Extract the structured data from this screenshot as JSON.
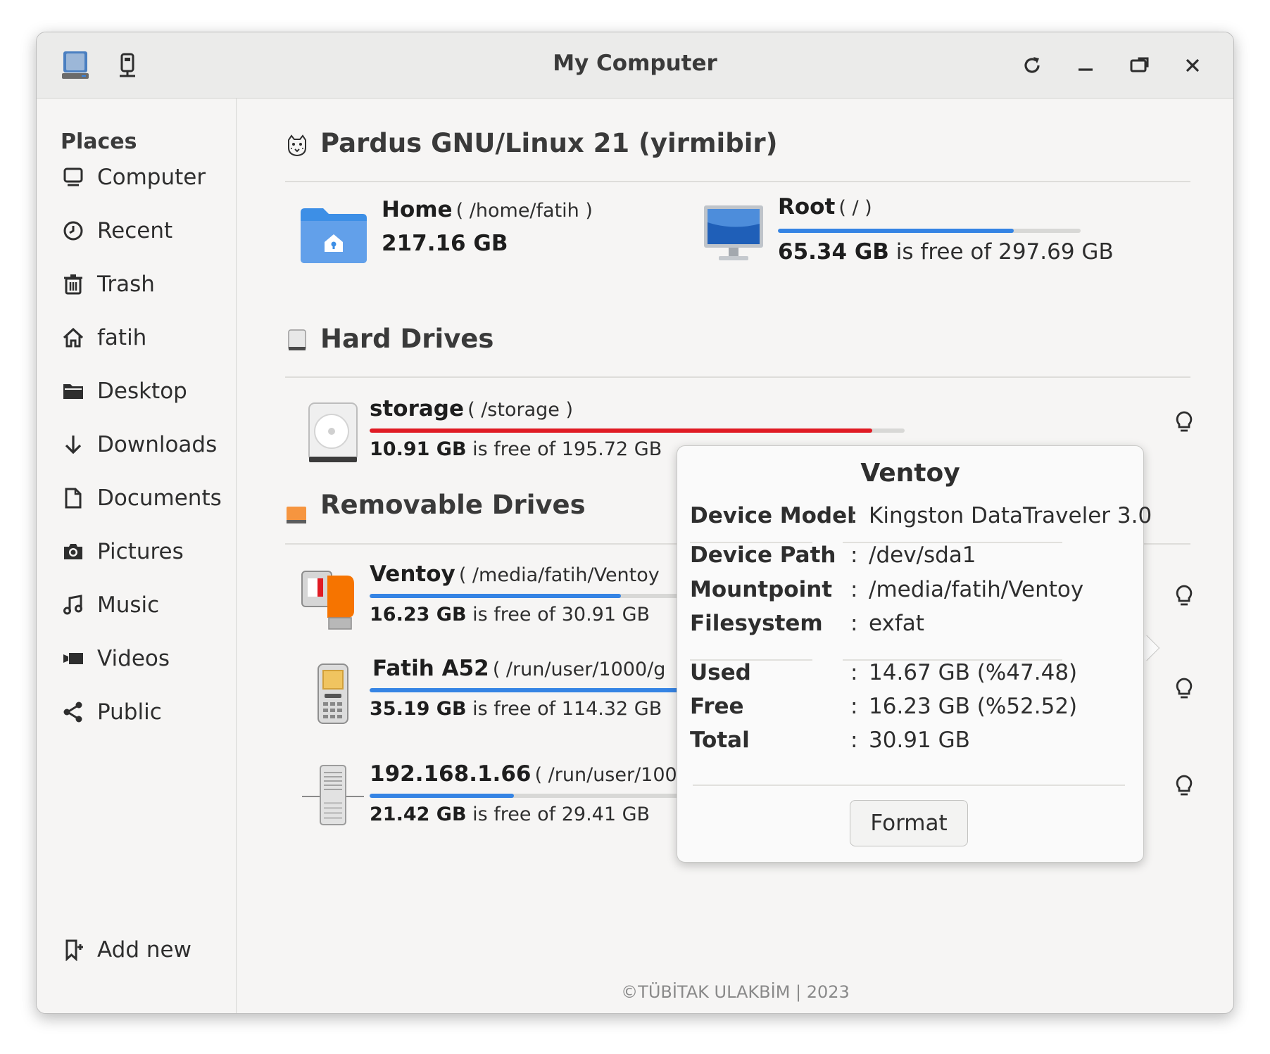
{
  "window": {
    "title": "My Computer"
  },
  "sidebar": {
    "title": "Places",
    "items": [
      {
        "label": "Computer",
        "icon": "computer-icon"
      },
      {
        "label": "Recent",
        "icon": "clock-icon"
      },
      {
        "label": "Trash",
        "icon": "trash-icon"
      },
      {
        "label": "fatih",
        "icon": "home-icon"
      },
      {
        "label": "Desktop",
        "icon": "folder-icon"
      },
      {
        "label": "Downloads",
        "icon": "download-arrow-icon"
      },
      {
        "label": "Documents",
        "icon": "document-icon"
      },
      {
        "label": "Pictures",
        "icon": "camera-icon"
      },
      {
        "label": "Music",
        "icon": "music-note-icon"
      },
      {
        "label": "Videos",
        "icon": "video-icon"
      },
      {
        "label": "Public",
        "icon": "share-icon"
      }
    ],
    "add_new": "Add new"
  },
  "system": {
    "title": "Pardus GNU/Linux 21 (yirmibir)",
    "home": {
      "name": "Home",
      "path": "( /home/fatih )",
      "size": "217.16 GB"
    },
    "root": {
      "name": "Root",
      "path": "( / )",
      "free": "65.34 GB",
      "free_text": "is free of 297.69 GB",
      "used_fraction": 0.78
    }
  },
  "hard_drives": {
    "title": "Hard Drives",
    "items": [
      {
        "name": "storage",
        "path": "( /storage )",
        "free": "10.91 GB",
        "free_text": "is free of 195.72 GB",
        "used_fraction": 0.94,
        "bar_color": "#e01b24"
      }
    ]
  },
  "removable_drives": {
    "title": "Removable Drives",
    "items": [
      {
        "name": "Ventoy",
        "path": "( /media/fatih/Ventoy",
        "free": "16.23 GB",
        "free_text": "is free of 30.91 GB",
        "used_fraction": 0.47,
        "bar_color": "#3584e4"
      },
      {
        "name": "Fatih A52",
        "path": "( /run/user/1000/g",
        "free": "35.19 GB",
        "free_text": "is free of 114.32 GB",
        "used_fraction": 0.69,
        "bar_color": "#3584e4"
      },
      {
        "name": "192.168.1.66",
        "path": "( /run/user/100",
        "free": "21.42 GB",
        "free_text": "is free of 29.41 GB",
        "used_fraction": 0.27,
        "bar_color": "#3584e4"
      }
    ]
  },
  "popover": {
    "title": "Ventoy",
    "model_key": "Device Model",
    "model_val": "Kingston DataTraveler 3.0",
    "path_key": "Device Path",
    "path_val": "/dev/sda1",
    "mount_key": "Mountpoint",
    "mount_val": "/media/fatih/Ventoy",
    "fs_key": "Filesystem",
    "fs_val": "exfat",
    "used_key": "Used",
    "used_val": "14.67 GB (%47.48)",
    "free_key": "Free",
    "free_val": "16.23 GB (%52.52)",
    "total_key": "Total",
    "total_val": "30.91 GB",
    "colon": ":",
    "format_label": "Format"
  },
  "footer": "©TÜBİTAK ULAKBİM | 2023",
  "colors": {
    "accent": "#3584e4",
    "danger": "#e01b24",
    "folder": "#3d8fe6"
  }
}
